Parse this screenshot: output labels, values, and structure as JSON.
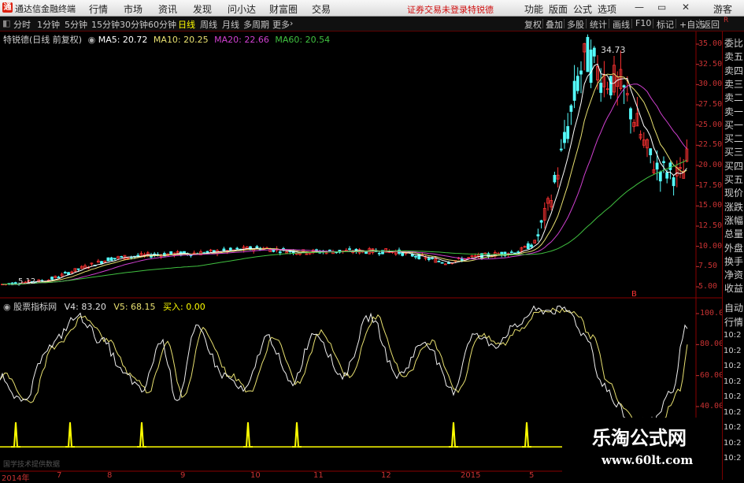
{
  "titlebar": {
    "app_title": "通达信金融终端",
    "menus": [
      "行情",
      "市场",
      "资讯",
      "发现",
      "问小达",
      "财富圈",
      "交易"
    ],
    "status": "证券交易未登录",
    "stock": "特锐德",
    "right_menus": [
      "功能",
      "版面",
      "公式",
      "选项"
    ],
    "guest": "游客"
  },
  "toolbar": {
    "periods": [
      "分时",
      "1分钟",
      "5分钟",
      "15分钟",
      "30分钟",
      "60分钟",
      "日线",
      "周线",
      "月线",
      "多周期",
      "更多"
    ],
    "selected_period": "日线",
    "right_buttons": [
      "复权",
      "叠加",
      "多股",
      "统计",
      "画线",
      "F10",
      "标记",
      "+自选",
      "返回"
    ]
  },
  "main_chart": {
    "title": "特锐德(日线 前复权)",
    "ma": [
      {
        "label": "MA5: 20.72",
        "color": "#ffffff"
      },
      {
        "label": "MA10: 20.25",
        "color": "#e8e070"
      },
      {
        "label": "MA20: 22.66",
        "color": "#d040d0"
      },
      {
        "label": "MA60: 20.54",
        "color": "#40c040"
      }
    ],
    "y_ticks": [
      "35.00",
      "32.50",
      "30.00",
      "27.50",
      "25.00",
      "22.50",
      "20.00",
      "17.50",
      "15.00",
      "12.50",
      "10.00",
      "7.50",
      "5.00"
    ],
    "high_label": "34.73",
    "low_label": "5.12",
    "marker": "B"
  },
  "indicator": {
    "title": "股票指标网",
    "v4": "V4: 83.20",
    "v5": "V5: 68.15",
    "buy": "买入: 0.00",
    "y_ticks": [
      "100.0",
      "80.00",
      "60.00",
      "40.00"
    ],
    "source_label": "国学技术提供数据"
  },
  "dates": [
    "2014年",
    "7",
    "8",
    "9",
    "10",
    "11",
    "12",
    "2015",
    "3",
    "5"
  ],
  "right_panel": {
    "items": [
      "委比",
      "卖五",
      "卖四",
      "卖三",
      "卖二",
      "卖一",
      "买一",
      "买二",
      "买三",
      "买四",
      "买五",
      "现价",
      "涨跌",
      "涨幅",
      "总量",
      "外盘",
      "换手",
      "净资",
      "收益"
    ],
    "mid": [
      "自动",
      "行情"
    ],
    "times": [
      "10:2",
      "10:2",
      "10:2",
      "10:2",
      "10:2",
      "10:2",
      "10:2",
      "10:2",
      "10:2"
    ]
  },
  "watermark": {
    "cn": "乐淘公式网",
    "url": "www.60lt.com"
  },
  "colors": {
    "up": "#ff3232",
    "down": "#54fcfc",
    "axis": "#c83232",
    "ma5": "#ffffff",
    "ma10": "#e8e070",
    "ma20": "#d040d0",
    "ma60": "#40c040",
    "signal": "#ffff00"
  }
}
